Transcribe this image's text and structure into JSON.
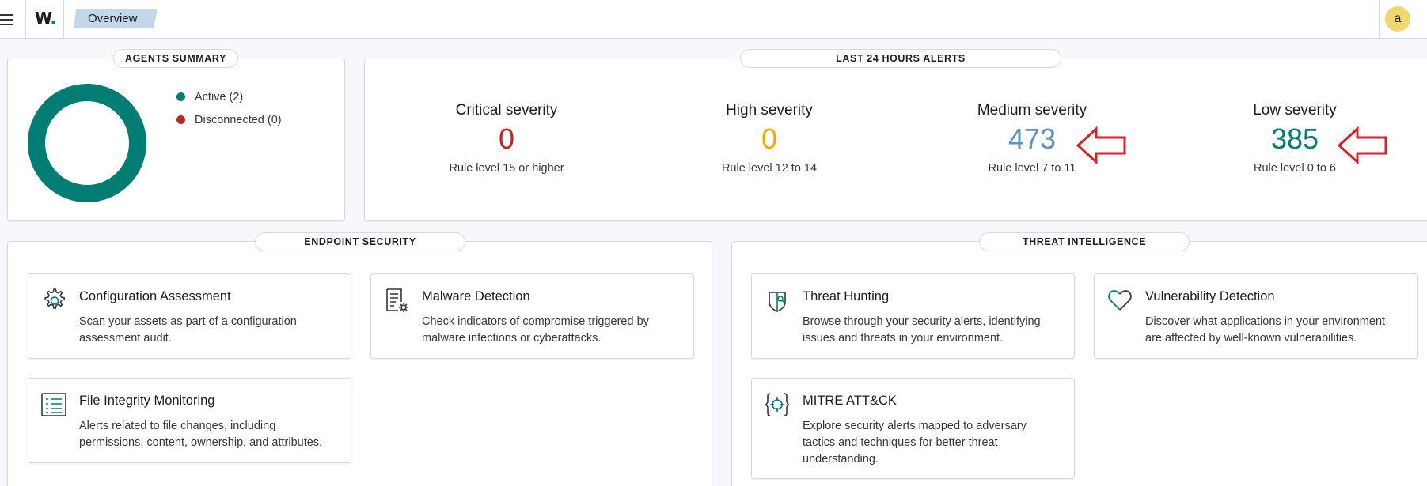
{
  "header": {
    "logo_text": "W",
    "logo_dot": ".",
    "breadcrumb": "Overview",
    "avatar_initial": "a"
  },
  "agents_summary": {
    "title": "AGENTS SUMMARY",
    "legend": [
      {
        "label": "Active (2)",
        "color": "#017d73",
        "count": 2
      },
      {
        "label": "Disconnected (0)",
        "color": "#bd271e",
        "count": 0
      }
    ]
  },
  "alerts": {
    "title": "LAST 24 HOURS ALERTS",
    "items": [
      {
        "title": "Critical severity",
        "value": "0",
        "sub": "Rule level 15 or higher",
        "color": "#bd271e"
      },
      {
        "title": "High severity",
        "value": "0",
        "sub": "Rule level 12 to 14",
        "color": "#f5a700"
      },
      {
        "title": "Medium severity",
        "value": "473",
        "sub": "Rule level 7 to 11",
        "color": "#6092c0"
      },
      {
        "title": "Low severity",
        "value": "385",
        "sub": "Rule level 0 to 6",
        "color": "#017d73"
      }
    ],
    "annotation_arrow_color": "#d6202a"
  },
  "endpoint_security": {
    "title": "ENDPOINT SECURITY",
    "cards": [
      {
        "icon": "gear-icon",
        "title": "Configuration Assessment",
        "desc": "Scan your assets as part of a configuration assessment audit."
      },
      {
        "icon": "document-gear-icon",
        "title": "Malware Detection",
        "desc": "Check indicators of compromise triggered by malware infections or cyberattacks."
      },
      {
        "icon": "list-icon",
        "title": "File Integrity Monitoring",
        "desc": "Alerts related to file changes, including permissions, content, ownership, and attributes."
      }
    ]
  },
  "threat_intelligence": {
    "title": "THREAT INTELLIGENCE",
    "cards": [
      {
        "icon": "shield-icon",
        "title": "Threat Hunting",
        "desc": "Browse through your security alerts, identifying issues and threats in your environment."
      },
      {
        "icon": "heart-icon",
        "title": "Vulnerability Detection",
        "desc": "Discover what applications in your environment are affected by well-known vulnerabilities."
      },
      {
        "icon": "crosshair-braces-icon",
        "title": "MITRE ATT&CK",
        "desc": "Explore security alerts mapped to adversary tactics and techniques for better threat understanding."
      }
    ]
  }
}
